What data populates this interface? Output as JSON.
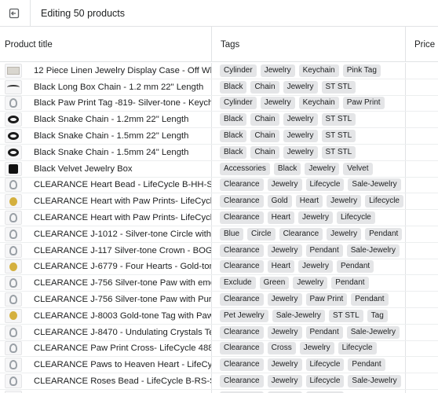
{
  "header": {
    "title": "Editing 50 products"
  },
  "columns": {
    "product": "Product title",
    "tags": "Tags",
    "price": "Price"
  },
  "rows": [
    {
      "thumb": "box",
      "title": "12 Piece Linen Jewelry Display Case - Off White",
      "tags": [
        "Cylinder",
        "Jewelry",
        "Keychain",
        "Pink Tag"
      ]
    },
    {
      "thumb": "line",
      "title": "Black Long Box Chain - 1.2 mm 22\" Length",
      "tags": [
        "Black",
        "Chain",
        "Jewelry",
        "ST STL"
      ]
    },
    {
      "thumb": "silver",
      "title": "Black Paw Print Tag -819- Silver-tone - Keychain",
      "tags": [
        "Cylinder",
        "Jewelry",
        "Keychain",
        "Paw Print"
      ]
    },
    {
      "thumb": "dark",
      "title": "Black Snake Chain - 1.2mm 22\" Length",
      "tags": [
        "Black",
        "Chain",
        "Jewelry",
        "ST STL"
      ]
    },
    {
      "thumb": "dark",
      "title": "Black Snake Chain - 1.5mm 22\" Length",
      "tags": [
        "Black",
        "Chain",
        "Jewelry",
        "ST STL"
      ]
    },
    {
      "thumb": "dark",
      "title": "Black Snake Chain - 1.5mm 24\" Length",
      "tags": [
        "Black",
        "Chain",
        "Jewelry",
        "ST STL"
      ]
    },
    {
      "thumb": "black",
      "title": "Black Velvet Jewelry Box",
      "tags": [
        "Accessories",
        "Black",
        "Jewelry",
        "Velvet"
      ]
    },
    {
      "thumb": "silver",
      "title": "CLEARANCE  Heart Bead - LifeCycle B-HH-S - Silver",
      "tags": [
        "Clearance",
        "Jewelry",
        "Lifecycle",
        "Sale-Jewelry"
      ]
    },
    {
      "thumb": "gold",
      "title": "CLEARANCE  Heart with Paw Prints- LifeCycle P-Gold",
      "tags": [
        "Clearance",
        "Gold",
        "Heart",
        "Jewelry",
        "Lifecycle"
      ]
    },
    {
      "thumb": "silver",
      "title": "CLEARANCE  Heart with Paw Prints- LifeCycle P-Silver",
      "tags": [
        "Clearance",
        "Heart",
        "Jewelry",
        "Lifecycle"
      ]
    },
    {
      "thumb": "silver",
      "title": "CLEARANCE  J-1012 - Silver-tone Circle with Cross",
      "tags": [
        "Blue",
        "Circle",
        "Clearance",
        "Jewelry",
        "Pendant"
      ]
    },
    {
      "thumb": "silver",
      "title": "CLEARANCE  J-117 Silver-tone Crown - BOGATTI",
      "tags": [
        "Clearance",
        "Jewelry",
        "Pendant",
        "Sale-Jewelry"
      ]
    },
    {
      "thumb": "gold",
      "title": "CLEARANCE  J-6779 - Four Hearts - Gold-tone",
      "tags": [
        "Clearance",
        "Heart",
        "Jewelry",
        "Pendant"
      ]
    },
    {
      "thumb": "silver",
      "title": "CLEARANCE  J-756 Silver-tone Paw with emerald",
      "tags": [
        "Exclude",
        "Green",
        "Jewelry",
        "Pendant"
      ]
    },
    {
      "thumb": "silver",
      "title": "CLEARANCE  J-756 Silver-tone Paw with Purple",
      "tags": [
        "Clearance",
        "Jewelry",
        "Paw Print",
        "Pendant"
      ]
    },
    {
      "thumb": "gold",
      "title": "CLEARANCE  J-8003 Gold-tone Tag with Paw Print",
      "tags": [
        "Pet Jewelry",
        "Sale-Jewelry",
        "ST STL",
        "Tag"
      ]
    },
    {
      "thumb": "silver",
      "title": "CLEARANCE  J-8470 - Undulating Crystals Teardrop",
      "tags": [
        "Clearance",
        "Jewelry",
        "Pendant",
        "Sale-Jewelry"
      ]
    },
    {
      "thumb": "silver",
      "title": "CLEARANCE  Paw Print Cross- LifeCycle 488 - Pewter",
      "tags": [
        "Clearance",
        "Cross",
        "Jewelry",
        "Lifecycle"
      ]
    },
    {
      "thumb": "silver",
      "title": "CLEARANCE  Paws to Heaven Heart - LifeCycle",
      "tags": [
        "Clearance",
        "Jewelry",
        "Lifecycle",
        "Pendant"
      ]
    },
    {
      "thumb": "silver",
      "title": "CLEARANCE  Roses Bead - LifeCycle B-RS-S - Silver",
      "tags": [
        "Clearance",
        "Jewelry",
        "Lifecycle",
        "Sale-Jewelry"
      ]
    },
    {
      "thumb": "silver",
      "title": "",
      "tags": [
        "Clearance",
        "Jewelry",
        "Lifecycle"
      ]
    }
  ]
}
